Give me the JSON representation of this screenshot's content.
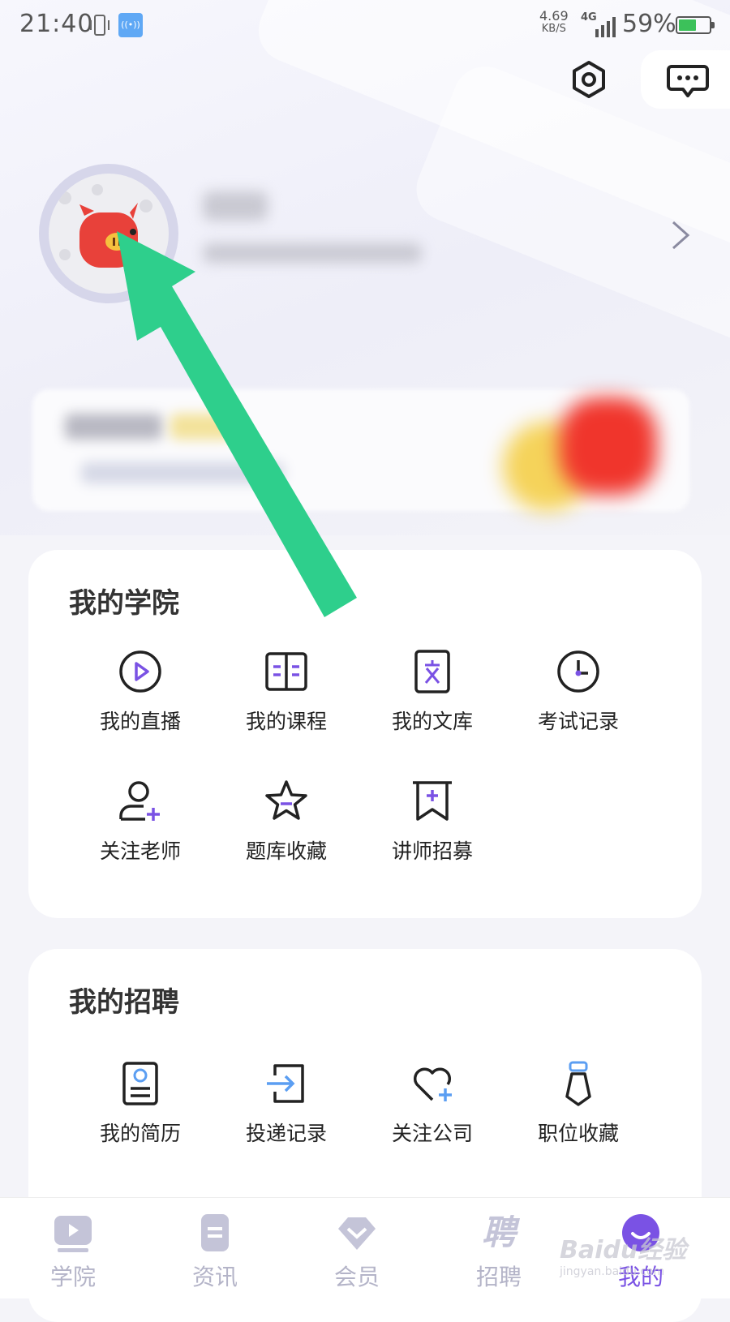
{
  "status_bar": {
    "time": "21:40",
    "net_speed_value": "4.69",
    "net_speed_unit": "KB/S",
    "network_type": "4G",
    "battery_percent": "59%",
    "battery_level": 0.59
  },
  "my_academy": {
    "title": "我的学院",
    "items": [
      {
        "label": "我的直播",
        "icon": "live-play-icon"
      },
      {
        "label": "我的课程",
        "icon": "book-icon"
      },
      {
        "label": "我的文库",
        "icon": "document-icon"
      },
      {
        "label": "考试记录",
        "icon": "clock-icon"
      },
      {
        "label": "关注老师",
        "icon": "add-user-icon"
      },
      {
        "label": "题库收藏",
        "icon": "star-icon"
      },
      {
        "label": "讲师招募",
        "icon": "bookmark-icon"
      }
    ]
  },
  "my_recruitment": {
    "title": "我的招聘",
    "items": [
      {
        "label": "我的简历",
        "icon": "resume-icon"
      },
      {
        "label": "投递记录",
        "icon": "send-icon"
      },
      {
        "label": "关注公司",
        "icon": "heart-add-icon"
      },
      {
        "label": "职位收藏",
        "icon": "tie-icon"
      }
    ]
  },
  "tab_bar": {
    "tabs": [
      {
        "label": "学院",
        "icon": "academy-icon"
      },
      {
        "label": "资讯",
        "icon": "news-icon"
      },
      {
        "label": "会员",
        "icon": "diamond-icon"
      },
      {
        "label": "招聘",
        "icon": "recruit-icon",
        "icon_text": "聘"
      },
      {
        "label": "我的",
        "icon": "profile-icon"
      }
    ],
    "active": "我的"
  },
  "colors": {
    "accent": "#7a52e4",
    "arrow": "#2ecf8c",
    "inactive_tab": "#b4b4c8"
  },
  "watermark": {
    "text": "Baidu经验",
    "url_text": "jingyan.baidu.com"
  }
}
